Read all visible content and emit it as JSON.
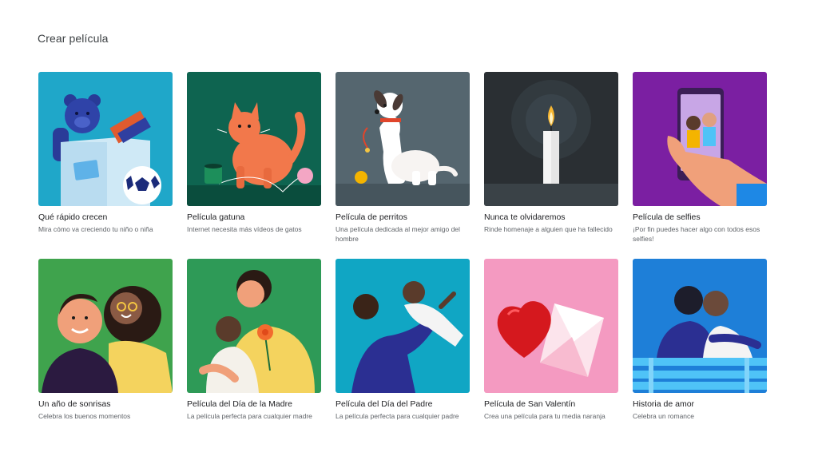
{
  "page": {
    "title": "Crear película"
  },
  "cards": [
    {
      "id": "kids",
      "title": "Qué rápido crecen",
      "description": "Mira cómo va creciendo tu niño o niña",
      "bg": "#1fa7c9"
    },
    {
      "id": "cats",
      "title": "Película gatuna",
      "description": "Internet necesita más vídeos de gatos",
      "bg": "#0e6450"
    },
    {
      "id": "dogs",
      "title": "Película de perritos",
      "description": "Una película dedicada al mejor amigo del hombre",
      "bg": "#55666f"
    },
    {
      "id": "memorial",
      "title": "Nunca te olvidaremos",
      "description": "Rinde homenaje a alguien que ha fallecido",
      "bg": "#2a2f33"
    },
    {
      "id": "selfies",
      "title": "Película de selfies",
      "description": "¡Por fin puedes hacer algo con todos esos selfies!",
      "bg": "#7b1fa2"
    },
    {
      "id": "smiles",
      "title": "Un año de sonrisas",
      "description": "Celebra los buenos momentos",
      "bg": "#3fa34d"
    },
    {
      "id": "mothers",
      "title": "Película del Día de la Madre",
      "description": "La película perfecta para cualquier madre",
      "bg": "#2e9a57"
    },
    {
      "id": "fathers",
      "title": "Película del Día del Padre",
      "description": "La película perfecta para cualquier padre",
      "bg": "#10a6c4"
    },
    {
      "id": "valentine",
      "title": "Película de San Valentín",
      "description": "Crea una película para tu media naranja",
      "bg": "#f49ac1"
    },
    {
      "id": "love",
      "title": "Historia de amor",
      "description": "Celebra un romance",
      "bg": "#1e7fd8"
    }
  ]
}
